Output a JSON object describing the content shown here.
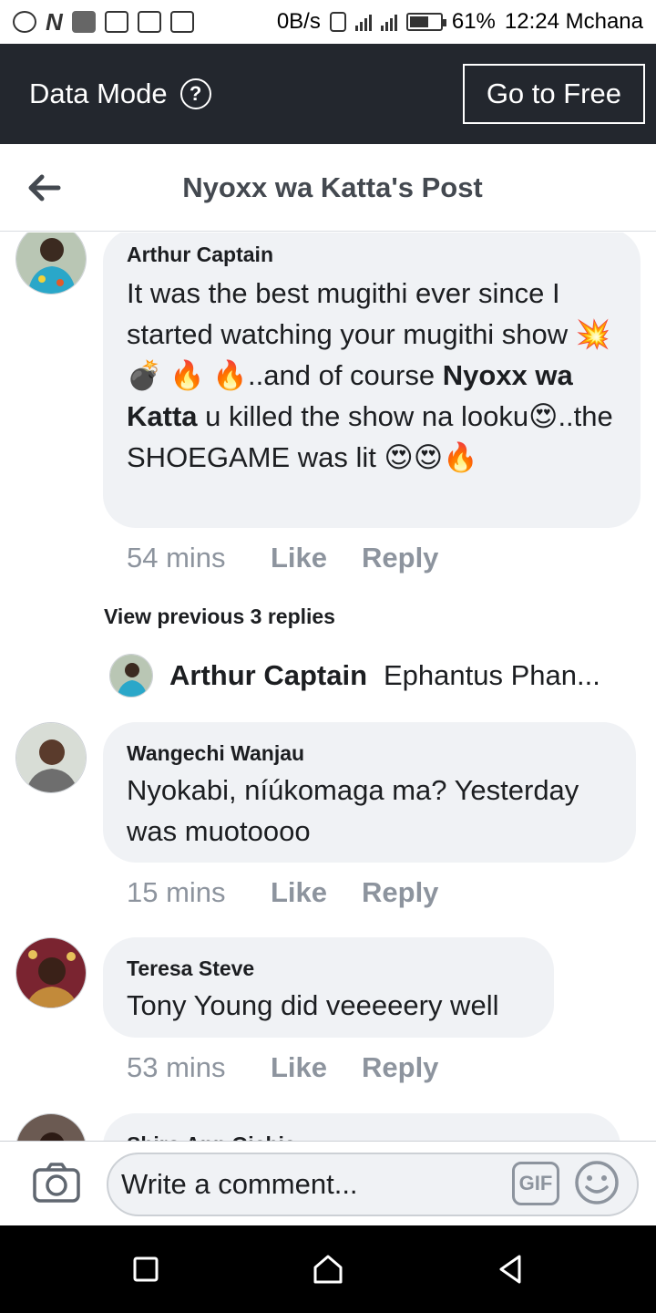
{
  "status_bar": {
    "network_speed": "0B/s",
    "battery": "61%",
    "battery_level": 0.61,
    "time": "12:24 Mchana"
  },
  "data_mode": {
    "label": "Data Mode",
    "help_icon": "?",
    "go_free": "Go to Free"
  },
  "header": {
    "title": "Nyoxx wa Katta's Post"
  },
  "comments": [
    {
      "name": "Arthur Captain",
      "text_parts": [
        "It was the best mugithi ever since I started watching your mugithi show 💥💣 🔥 🔥..and of course ",
        "Nyoxx wa Katta",
        " u killed the show na looku😍..the SHOEGAME was lit 😍😍🔥"
      ],
      "time": "54 mins",
      "like": "Like",
      "reply": "Reply"
    },
    {
      "name": "Wangechi Wanjau",
      "text": "Nyokabi, níúkomaga ma? Yesterday was muotoooo",
      "time": "15 mins",
      "like": "Like",
      "reply": "Reply"
    },
    {
      "name": "Teresa Steve",
      "text": "Tony Young did veeeeery well",
      "time": "53 mins",
      "like": "Like",
      "reply": "Reply"
    },
    {
      "name": "Shiro Ann Gichia"
    }
  ],
  "replies": {
    "view_previous": "View previous 3 replies",
    "latest_name": "Arthur Captain",
    "latest_text": "Ephantus Phan..."
  },
  "composer": {
    "placeholder": "Write a comment...",
    "gif_label": "GIF"
  }
}
